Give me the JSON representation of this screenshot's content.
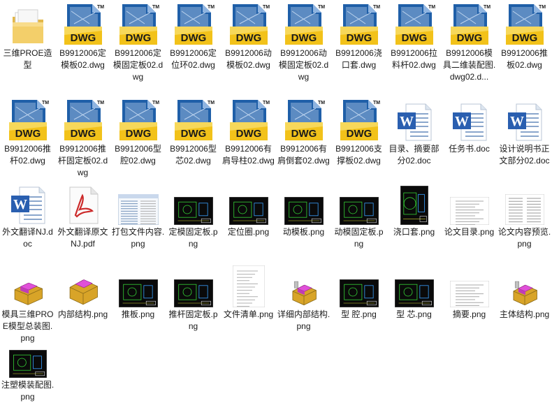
{
  "colors": {
    "background": "#ffffff",
    "dwg_yellow": "#f2c21a",
    "dwg_blue": "#1f5fa8",
    "word_blue": "#2a5fb0",
    "pdf_red": "#cc2a2a",
    "folder_yellow": "#f3cf6a",
    "cad_black": "#0a0a0a",
    "cad_green": "#35d035",
    "proe_magenta": "#e050d8",
    "proe_gold": "#d8a428"
  },
  "rows": [
    [
      {
        "name": "三维PROE造型",
        "icon": "folder-icon",
        "type": "folder"
      },
      {
        "name": "B9912006定模板02.dwg",
        "icon": "dwg-file-icon",
        "type": "dwg"
      },
      {
        "name": "B9912006定模固定板02.dwg",
        "icon": "dwg-file-icon",
        "type": "dwg"
      },
      {
        "name": "B9912006定位环02.dwg",
        "icon": "dwg-file-icon",
        "type": "dwg"
      },
      {
        "name": "B9912006动模板02.dwg",
        "icon": "dwg-file-icon",
        "type": "dwg"
      },
      {
        "name": "B9912006动模固定板02.dwg",
        "icon": "dwg-file-icon",
        "type": "dwg"
      },
      {
        "name": "B9912006浇口套.dwg",
        "icon": "dwg-file-icon",
        "type": "dwg"
      },
      {
        "name": "B9912006拉料杆02.dwg",
        "icon": "dwg-file-icon",
        "type": "dwg"
      },
      {
        "name": "B9912006模具二维装配图.dwg02.d...",
        "icon": "dwg-file-icon",
        "type": "dwg"
      },
      {
        "name": "B9912006推板02.dwg",
        "icon": "dwg-file-icon",
        "type": "dwg"
      }
    ],
    [
      {
        "name": "B9912006推杆02.dwg",
        "icon": "dwg-file-icon",
        "type": "dwg"
      },
      {
        "name": "B9912006推杆固定板02.dwg",
        "icon": "dwg-file-icon",
        "type": "dwg"
      },
      {
        "name": "B9912006型腔02.dwg",
        "icon": "dwg-file-icon",
        "type": "dwg"
      },
      {
        "name": "B9912006型芯02.dwg",
        "icon": "dwg-file-icon",
        "type": "dwg"
      },
      {
        "name": "B9912006有肩导柱02.dwg",
        "icon": "dwg-file-icon",
        "type": "dwg"
      },
      {
        "name": "B9912006有肩倒套02.dwg",
        "icon": "dwg-file-icon",
        "type": "dwg"
      },
      {
        "name": "B9912006支撑板02.dwg",
        "icon": "dwg-file-icon",
        "type": "dwg"
      },
      {
        "name": "目录、摘要部分02.doc",
        "icon": "word-doc-icon",
        "type": "doc"
      },
      {
        "name": "任务书.doc",
        "icon": "word-doc-icon",
        "type": "doc"
      },
      {
        "name": "设计说明书正文部分02.doc",
        "icon": "word-doc-icon",
        "type": "doc"
      }
    ],
    [
      {
        "name": "外文翻译NJ.doc",
        "icon": "word-doc-icon",
        "type": "doc"
      },
      {
        "name": "外文翻译原文NJ.pdf",
        "icon": "pdf-file-icon",
        "type": "pdf"
      },
      {
        "name": "打包文件内容.png",
        "icon": "screenshot-thumbnail-icon",
        "type": "list-thumb"
      },
      {
        "name": "定模固定板.png",
        "icon": "cad-drawing-thumbnail-icon",
        "type": "cad-thumb"
      },
      {
        "name": "定位圈.png",
        "icon": "cad-drawing-thumbnail-icon",
        "type": "cad-thumb"
      },
      {
        "name": "动模板.png",
        "icon": "cad-drawing-thumbnail-icon",
        "type": "cad-thumb"
      },
      {
        "name": "动模固定板.png",
        "icon": "cad-drawing-thumbnail-icon",
        "type": "cad-thumb"
      },
      {
        "name": "浇口套.png",
        "icon": "cad-drawing-thumbnail-icon",
        "type": "cad-tall"
      },
      {
        "name": "论文目录.png",
        "icon": "document-thumbnail-icon",
        "type": "paper-thumb"
      },
      {
        "name": "论文内容预览.png",
        "icon": "document-thumbnail-icon",
        "type": "paper-thumb2"
      }
    ],
    [
      {
        "name": "模具三维PROE模型总装图.png",
        "icon": "3d-model-thumbnail-icon",
        "type": "proe-thumb"
      },
      {
        "name": "内部结构.png",
        "icon": "3d-model-thumbnail-icon",
        "type": "proe-thumb2"
      },
      {
        "name": "推板.png",
        "icon": "cad-drawing-thumbnail-icon",
        "type": "cad-thumb"
      },
      {
        "name": "推杆固定板.png",
        "icon": "cad-drawing-thumbnail-icon",
        "type": "cad-thumb"
      },
      {
        "name": "文件清单.png",
        "icon": "document-thumbnail-icon",
        "type": "list-tall"
      },
      {
        "name": "详细内部结构.png",
        "icon": "3d-model-thumbnail-icon",
        "type": "proe-thumb3"
      },
      {
        "name": "型 腔.png",
        "icon": "cad-drawing-thumbnail-icon",
        "type": "cad-thumb"
      },
      {
        "name": "型 芯.png",
        "icon": "cad-drawing-thumbnail-icon",
        "type": "cad-thumb"
      },
      {
        "name": "摘要.png",
        "icon": "document-thumbnail-icon",
        "type": "paper-thumb3"
      },
      {
        "name": "主体结构.png",
        "icon": "3d-model-thumbnail-icon",
        "type": "proe-thumb3"
      }
    ],
    [
      {
        "name": "注塑模装配图.png",
        "icon": "cad-drawing-thumbnail-icon",
        "type": "cad-small"
      }
    ]
  ]
}
